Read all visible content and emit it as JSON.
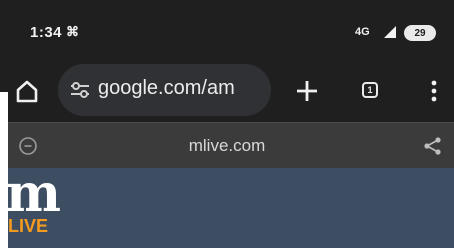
{
  "status_bar": {
    "time": "1:34",
    "network": "4G",
    "battery": "29"
  },
  "toolbar": {
    "url": "google.com/am",
    "tab_count": "1"
  },
  "custom_tab": {
    "domain": "mlive.com"
  },
  "site": {
    "logo_letter": "m",
    "logo_sub": "LIVE"
  },
  "colors": {
    "chrome_dark": "#1f1f1f",
    "omnibox": "#303134",
    "custom_tab_bar": "#3b3b3c",
    "page_header": "#3d4e62",
    "logo_accent": "#f39a1f"
  },
  "icons": [
    "notification-icon",
    "signal-icon",
    "home-icon",
    "tune-icon",
    "plus-icon",
    "tab-switcher-icon",
    "more-vert-icon",
    "info-icon",
    "share-icon"
  ]
}
